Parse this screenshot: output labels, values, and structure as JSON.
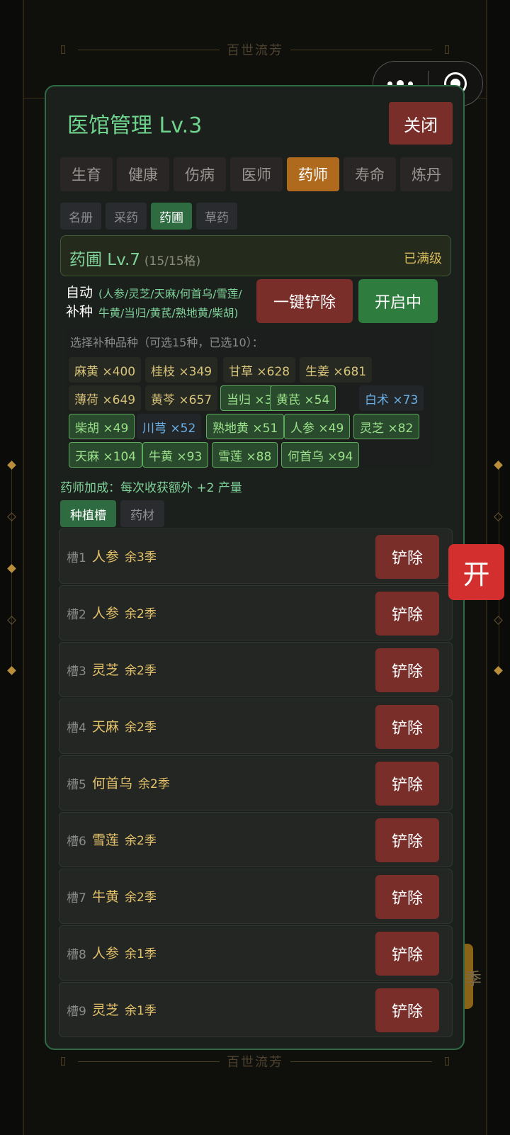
{
  "background": {
    "banner_text": "百世流芳",
    "side_season_text": "季"
  },
  "floating": {
    "open_label": "开"
  },
  "panel": {
    "title": "医馆管理 Lv.3",
    "close_label": "关闭",
    "tabs": [
      "生育",
      "健康",
      "伤病",
      "医师",
      "药师",
      "寿命",
      "炼丹"
    ],
    "active_tab": "药师",
    "subtabs": [
      "名册",
      "采药",
      "药圃",
      "草药"
    ],
    "active_subtab": "药圃",
    "garden": {
      "name": "药圃 Lv.7",
      "capacity": "(15/15格)",
      "status": "已满级"
    },
    "auto_replant": {
      "label_line1": "自动",
      "label_line2": "补种",
      "herbs_line1": "(人参/灵芝/天麻/何首乌/雪莲/",
      "herbs_line2": "牛黄/当归/黄芪/熟地黄/柴胡)",
      "clear_all_label": "一键铲除",
      "toggle_label": "开启中"
    },
    "seed_selection": {
      "hint": "选择补种品种（可选15种，已选10）：",
      "herbs": [
        {
          "label": "麻黄 ×400",
          "state": "yellow"
        },
        {
          "label": "桂枝 ×349",
          "state": "yellow"
        },
        {
          "label": "甘草 ×628",
          "state": "yellow"
        },
        {
          "label": "生姜 ×681",
          "state": "yellow"
        },
        {
          "label": "薄荷 ×649",
          "state": "yellow"
        },
        {
          "label": "黄芩 ×657",
          "state": "yellow"
        },
        {
          "label": "当归 ×30",
          "state": "green"
        },
        {
          "label": "黄芪 ×54",
          "state": "green"
        },
        {
          "label": "白术 ×73",
          "state": "blue"
        },
        {
          "label": "柴胡 ×49",
          "state": "green"
        },
        {
          "label": "川芎 ×52",
          "state": "blue"
        },
        {
          "label": "熟地黄 ×51",
          "state": "green"
        },
        {
          "label": "人参 ×49",
          "state": "green"
        },
        {
          "label": "灵芝 ×82",
          "state": "green"
        },
        {
          "label": "天麻 ×104",
          "state": "green"
        },
        {
          "label": "牛黄 ×93",
          "state": "green"
        },
        {
          "label": "雪莲 ×88",
          "state": "green"
        },
        {
          "label": "何首乌 ×94",
          "state": "green"
        }
      ]
    },
    "bonus_text": "药师加成：每次收获额外 +2 产量",
    "list_tabs": [
      "种植槽",
      "药材"
    ],
    "active_list_tab": "种植槽",
    "slots": [
      {
        "no": "槽1",
        "herb": "人参",
        "remain": "余3季",
        "action": "铲除"
      },
      {
        "no": "槽2",
        "herb": "人参",
        "remain": "余2季",
        "action": "铲除"
      },
      {
        "no": "槽3",
        "herb": "灵芝",
        "remain": "余2季",
        "action": "铲除"
      },
      {
        "no": "槽4",
        "herb": "天麻",
        "remain": "余2季",
        "action": "铲除"
      },
      {
        "no": "槽5",
        "herb": "何首乌",
        "remain": "余2季",
        "action": "铲除"
      },
      {
        "no": "槽6",
        "herb": "雪莲",
        "remain": "余2季",
        "action": "铲除"
      },
      {
        "no": "槽7",
        "herb": "牛黄",
        "remain": "余2季",
        "action": "铲除"
      },
      {
        "no": "槽8",
        "herb": "人参",
        "remain": "余1季",
        "action": "铲除"
      },
      {
        "no": "槽9",
        "herb": "灵芝",
        "remain": "余1季",
        "action": "铲除"
      }
    ]
  },
  "colors": {
    "accent_green": "#6fd58e",
    "active_tab": "#b06a1e",
    "danger": "#7a2e2a",
    "enabled": "#2e7d3e"
  }
}
